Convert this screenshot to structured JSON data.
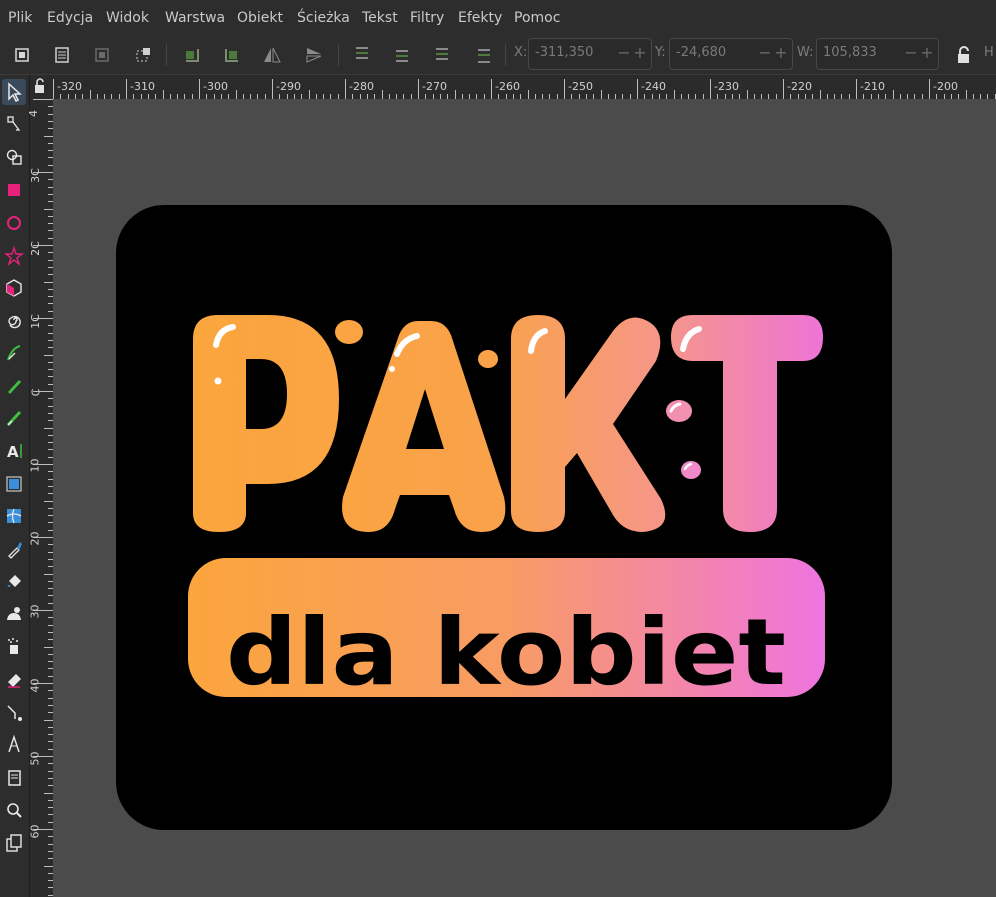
{
  "menu": [
    "Plik",
    "Edycja",
    "Widok",
    "Warstwa",
    "Obiekt",
    "Ścieżka",
    "Tekst",
    "Filtry",
    "Efekty",
    "Pomoc"
  ],
  "toolbar": {
    "x": {
      "label": "X:",
      "value": "-311,350"
    },
    "y": {
      "label": "Y:",
      "value": "-24,680"
    },
    "w": {
      "label": "W:",
      "value": "105,833"
    },
    "h_label": "H",
    "spin_minus": "−",
    "spin_plus": "+",
    "icons": [
      "select-all-icon",
      "select-all-layers-icon",
      "deselect-icon",
      "select-same-icon",
      "rotate-ccw-icon",
      "rotate-cw-icon",
      "flip-horizontal-icon",
      "flip-vertical-icon",
      "raise-to-top-icon",
      "raise-icon",
      "lower-icon",
      "lower-to-bottom-icon"
    ],
    "lock_icon": "lock-icon"
  },
  "tools": [
    "selector-tool-icon",
    "node-tool-icon",
    "shape-builder-tool-icon",
    "rectangle-tool-icon",
    "ellipse-tool-icon",
    "star-tool-icon",
    "box-3d-tool-icon",
    "spiral-tool-icon",
    "bezier-pen-tool-icon",
    "pencil-tool-icon",
    "calligraphy-tool-icon",
    "text-tool-icon",
    "gradient-tool-icon",
    "mesh-tool-icon",
    "dropper-tool-icon",
    "paint-bucket-tool-icon",
    "tweak-tool-icon",
    "spray-tool-icon",
    "eraser-tool-icon",
    "connector-tool-icon",
    "measure-tool-icon",
    "pages-tool-icon",
    "zoom-tool-icon",
    "page-tool-icon"
  ],
  "rulers": {
    "horizontal": [
      "-320",
      "-310",
      "-300",
      "-290",
      "-280",
      "-270",
      "-260",
      "-250",
      "-240",
      "-230",
      "-220",
      "-210",
      "-200"
    ],
    "vertical": [
      "4",
      "3C",
      "2C",
      "1C",
      "C",
      "10",
      "20",
      "30",
      "40",
      "50",
      "60"
    ],
    "corner_icon": "ruler-lock-icon"
  },
  "artwork": {
    "title_letters": [
      "P",
      "A",
      "K",
      "T"
    ],
    "subtitle": "dla kobiet",
    "colors": {
      "background": "#000000",
      "canvas": "#4b4b4b",
      "gradient_start": "#fba53d",
      "gradient_mid": "#f5968a",
      "gradient_end": "#ee74d6",
      "highlight": "#ffffff"
    }
  }
}
